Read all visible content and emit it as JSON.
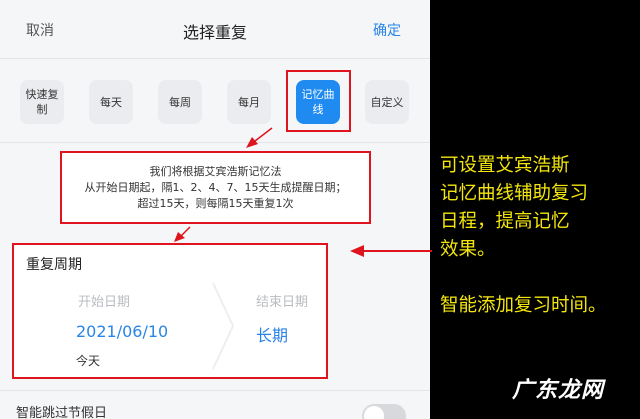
{
  "header": {
    "cancel": "取消",
    "title": "选择重复",
    "confirm": "确定"
  },
  "options": [
    {
      "label": "快速复制"
    },
    {
      "label": "每天"
    },
    {
      "label": "每周"
    },
    {
      "label": "每月"
    },
    {
      "label": "记忆曲线"
    },
    {
      "label": "自定义"
    }
  ],
  "note": {
    "line1": "我们将根据艾宾浩斯记忆法",
    "line2": "从开始日期起，隔1、2、4、7、15天生成提醒日期；",
    "line3": "超过15天，则每隔15天重复1次"
  },
  "card": {
    "title": "重复周期",
    "start_label": "开始日期",
    "end_label": "结束日期",
    "start_value": "2021/06/10",
    "end_value": "长期",
    "start_sub": "今天"
  },
  "holiday": {
    "label": "智能跳过节假日"
  },
  "annotation": {
    "line1": "可设置艾宾浩斯",
    "line2": "记忆曲线辅助复习",
    "line3": "日程，提高记忆",
    "line4": "效果。",
    "line5": "智能添加复习时间。"
  },
  "watermark": "广东龙网",
  "colors": {
    "accent": "#2a84e6",
    "highlight": "#e0141e",
    "annotation": "#f4e60c"
  }
}
